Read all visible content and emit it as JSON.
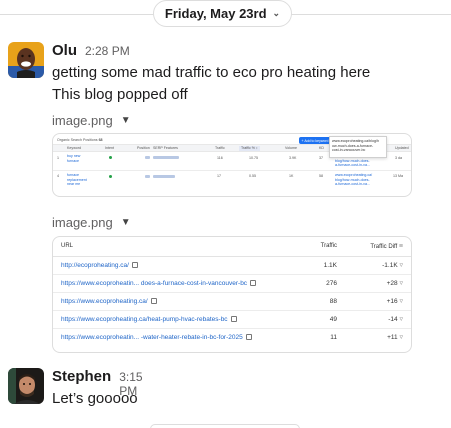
{
  "date_divider": {
    "label": "Friday, May 23rd"
  },
  "messages": [
    {
      "sender": "Olu",
      "time": "2:28 PM",
      "lines": [
        "getting some mad traffic to eco pro heating here",
        "This blog popped off"
      ],
      "attachments": [
        {
          "name": "image.png",
          "tiny": {
            "title": "Organic Search Positions",
            "count": "68",
            "add_btn": "+ Add to keyword",
            "col_keyword": "Keyword",
            "col_intent": "Intent",
            "col_position": "Position",
            "col_serp": "SERP Features",
            "col_traffic": "Traffic",
            "col_traffic_pct": "Traffic % ↕",
            "col_volume": "Volume",
            "col_kd": "KD",
            "col_url": "URL",
            "col_updated": "Updated",
            "row1_keyword_a": "buy new",
            "row1_keyword_b": "furnace",
            "row1_traffic": "116",
            "row1_pct": "10.75",
            "row1_volume": "3.9K",
            "row1_kd": "37",
            "row1_url_a": "www.ecoproheating.ca/",
            "row1_url_b": "blog/how-much-does-",
            "row1_url_c": "a-furnace-cost-in-va...",
            "row1_updated": "3 da",
            "row2_keyword_a": "furnace",
            "row2_keyword_b": "replacement",
            "row2_keyword_c": "near me",
            "row2_traffic": "17",
            "row2_pct": "0.55",
            "row2_volume": "1K",
            "row2_kd": "58",
            "row2_url_a": "www.ecoproheating.ca/",
            "row2_url_b": "blog/how-much-does-",
            "row2_url_c": "a-furnace-cost-in-va...",
            "row2_updated": "13 Ma",
            "tooltip_a": "www.ecoproheating.ca/blog/h",
            "tooltip_b": "ow-much-does-a-furnace-",
            "tooltip_c": "cost-in-vancouver-bc"
          }
        },
        {
          "name": "image.png",
          "table": {
            "headers": {
              "url": "URL",
              "traffic": "Traffic",
              "traffic_diff": "Traffic Diff"
            },
            "rows": [
              {
                "url": "http://ecoproheating.ca/",
                "traffic": "1.1K",
                "diff": "-1.1K"
              },
              {
                "url": "https://www.ecoproheatin... does-a-furnace-cost-in-vancouver-bc",
                "traffic": "276",
                "diff": "+28"
              },
              {
                "url": "https://www.ecoproheating.ca/",
                "traffic": "88",
                "diff": "+16"
              },
              {
                "url": "https://www.ecoproheating.ca/heat-pump-hvac-rebates-bc",
                "traffic": "49",
                "diff": "-14"
              },
              {
                "url": "https://www.ecoproheatin... -water-heater-rebate-in-bc-for-2025",
                "traffic": "11",
                "diff": "+11"
              }
            ]
          }
        }
      ]
    },
    {
      "sender": "Stephen",
      "time": "3:15 PM",
      "lines": [
        "Let’s gooooo"
      ]
    }
  ]
}
